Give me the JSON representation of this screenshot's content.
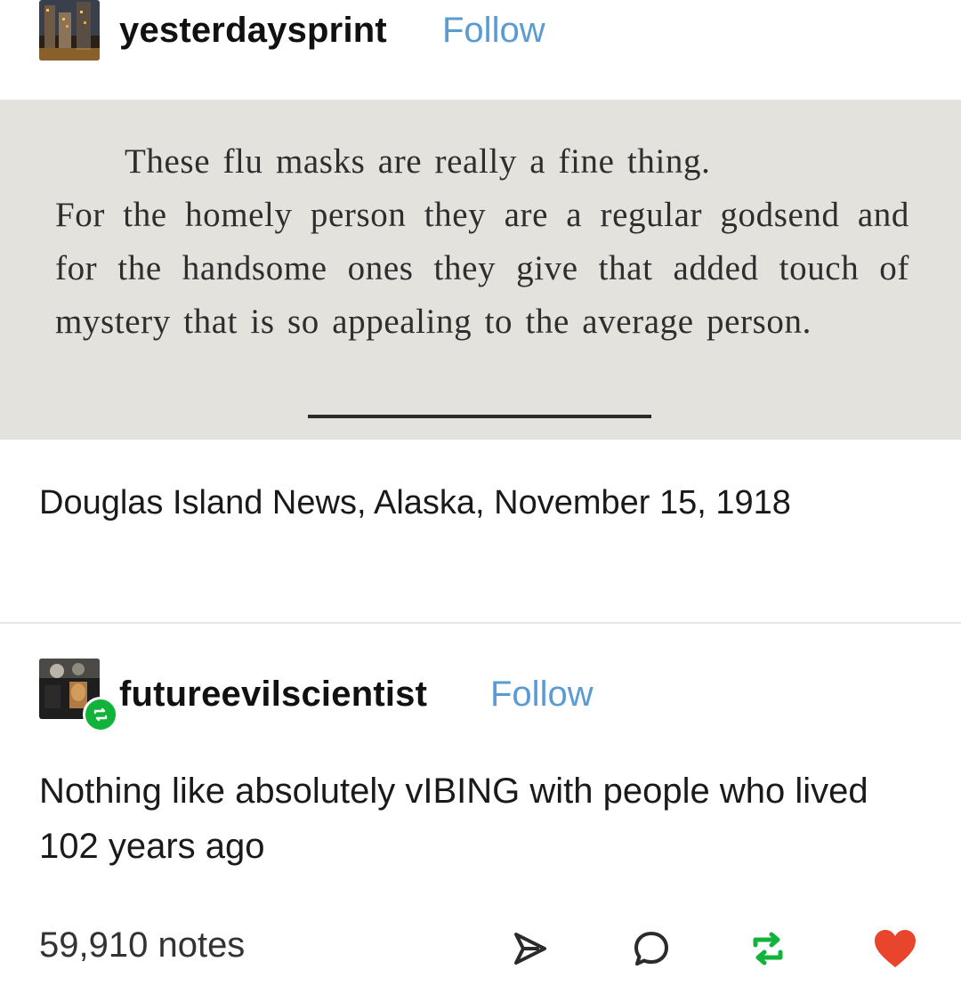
{
  "post": {
    "author": "yesterdaysprint",
    "follow_label": "Follow",
    "clipping": {
      "lines": [
        "These flu masks are really a fine thing.",
        "For the homely person they are a regular godsend and for the handsome ones they give that added touch of mystery that is so appealing to the average person."
      ]
    },
    "caption": "Douglas Island News, Alaska, November 15, 1918"
  },
  "reblog": {
    "author": "futureevilscientist",
    "follow_label": "Follow",
    "text": "Nothing like absolutely vIBING with people who lived 102 years ago"
  },
  "footer": {
    "notes": "59,910 notes",
    "actions": [
      "share-icon",
      "reply-icon",
      "reblog-icon",
      "like-icon"
    ]
  },
  "colors": {
    "follow": "#5a9bd4",
    "reblog_green": "#12b33a",
    "like_red": "#e8452c",
    "clipping_bg": "#e3e2dd"
  }
}
